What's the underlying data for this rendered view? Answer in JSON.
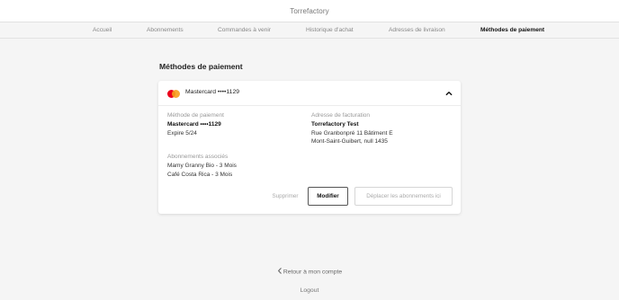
{
  "brand": "Torrefactory",
  "nav": {
    "items": [
      {
        "label": "Accueil"
      },
      {
        "label": "Abonnements"
      },
      {
        "label": "Commandes à venir"
      },
      {
        "label": "Historique d'achat"
      },
      {
        "label": "Adresses de livraison"
      },
      {
        "label": "Méthodes de paiement"
      }
    ],
    "active": "Méthodes de paiement"
  },
  "page": {
    "title": "Méthodes de paiement"
  },
  "card": {
    "header_label": "Mastercard ••••1129",
    "card_brand_icon": "mastercard-logo",
    "toggle_icon": "chevron-up-icon",
    "payment": {
      "heading": "Méthode de paiement",
      "name": "Mastercard ••••1129",
      "expiry": "Expire 5/24"
    },
    "billing": {
      "heading": "Adresse de facturation",
      "name": "Torrefactory Test",
      "line1": "Rue Granbonpré 11 Bâtiment E",
      "line2": "Mont-Saint-Guibert, null 1435"
    },
    "subscriptions": {
      "heading": "Abonnements associés",
      "items": [
        "Mamy Granny Bio - 3 Mois",
        "Café Costa Rica - 3 Mois"
      ]
    },
    "actions": {
      "delete": "Supprimer",
      "edit": "Modifier",
      "move": "Déplacer les abonnements ici"
    }
  },
  "footer": {
    "back": "Retour à mon compte",
    "back_icon": "chevron-left-icon",
    "logout": "Logout"
  },
  "colors": {
    "background": "#f5f5f5",
    "card": "#ffffff",
    "mastercard_red": "#eb001b",
    "mastercard_orange": "#f79e1b"
  }
}
